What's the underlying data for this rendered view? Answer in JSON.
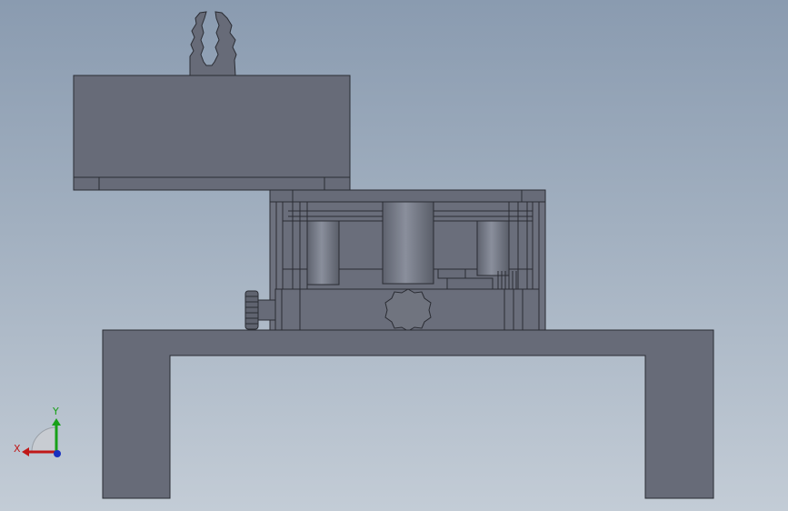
{
  "view": {
    "background_top": "#8a9bb0",
    "background_bottom": "#c3ccd6",
    "part_fill": "#676b78",
    "part_stroke": "#2a2c33"
  },
  "triad": {
    "x_label": "X",
    "y_label": "Y",
    "x_color": "#c01818",
    "y_color": "#18a018",
    "z_color": "#1830c0"
  }
}
